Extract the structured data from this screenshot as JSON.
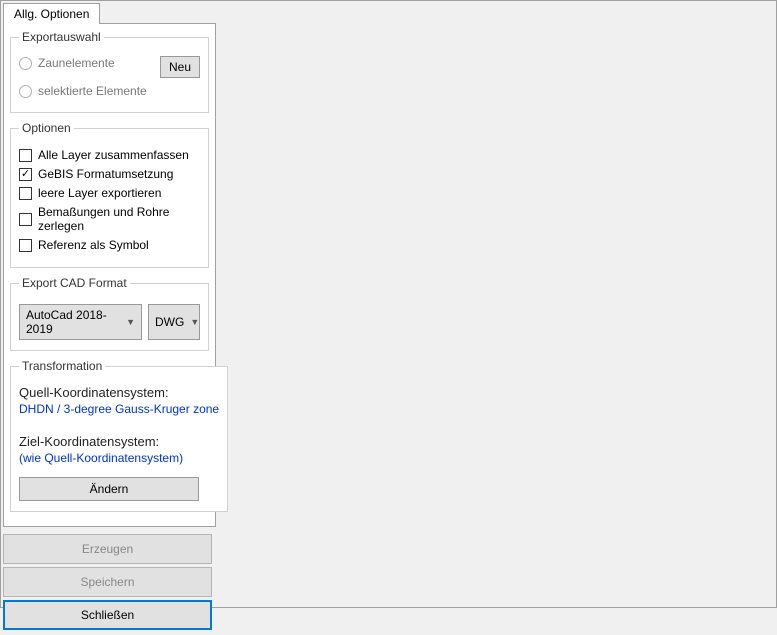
{
  "tabs": {
    "main": "Allg. Optionen"
  },
  "groups": {
    "exportauswahl": {
      "legend": "Exportauswahl",
      "radios": {
        "zaunelemente": "Zaunelemente",
        "selektierte": "selektierte Elemente"
      },
      "neu_button": "Neu"
    },
    "optionen": {
      "legend": "Optionen",
      "checks": {
        "alle_layer": "Alle Layer zusammenfassen",
        "gebis": "GeBIS Formatumsetzung",
        "leere_layer": "leere Layer exportieren",
        "bemassungen": "Bemaßungen und Rohre zerlegen",
        "referenz": "Referenz als Symbol"
      }
    },
    "export_cad": {
      "legend": "Export CAD Format",
      "version": "AutoCad 2018-2019",
      "format": "DWG"
    },
    "transformation": {
      "legend": "Transformation",
      "quell_label": "Quell-Koordinatensystem:",
      "quell_value": "DHDN / 3-degree Gauss-Kruger zone",
      "ziel_label": "Ziel-Koordinatensystem:",
      "ziel_value": "(wie Quell-Koordinatensystem)",
      "aendern_button": "Ändern"
    }
  },
  "bottom": {
    "erzeugen": "Erzeugen",
    "speichern": "Speichern",
    "schliessen": "Schließen"
  }
}
